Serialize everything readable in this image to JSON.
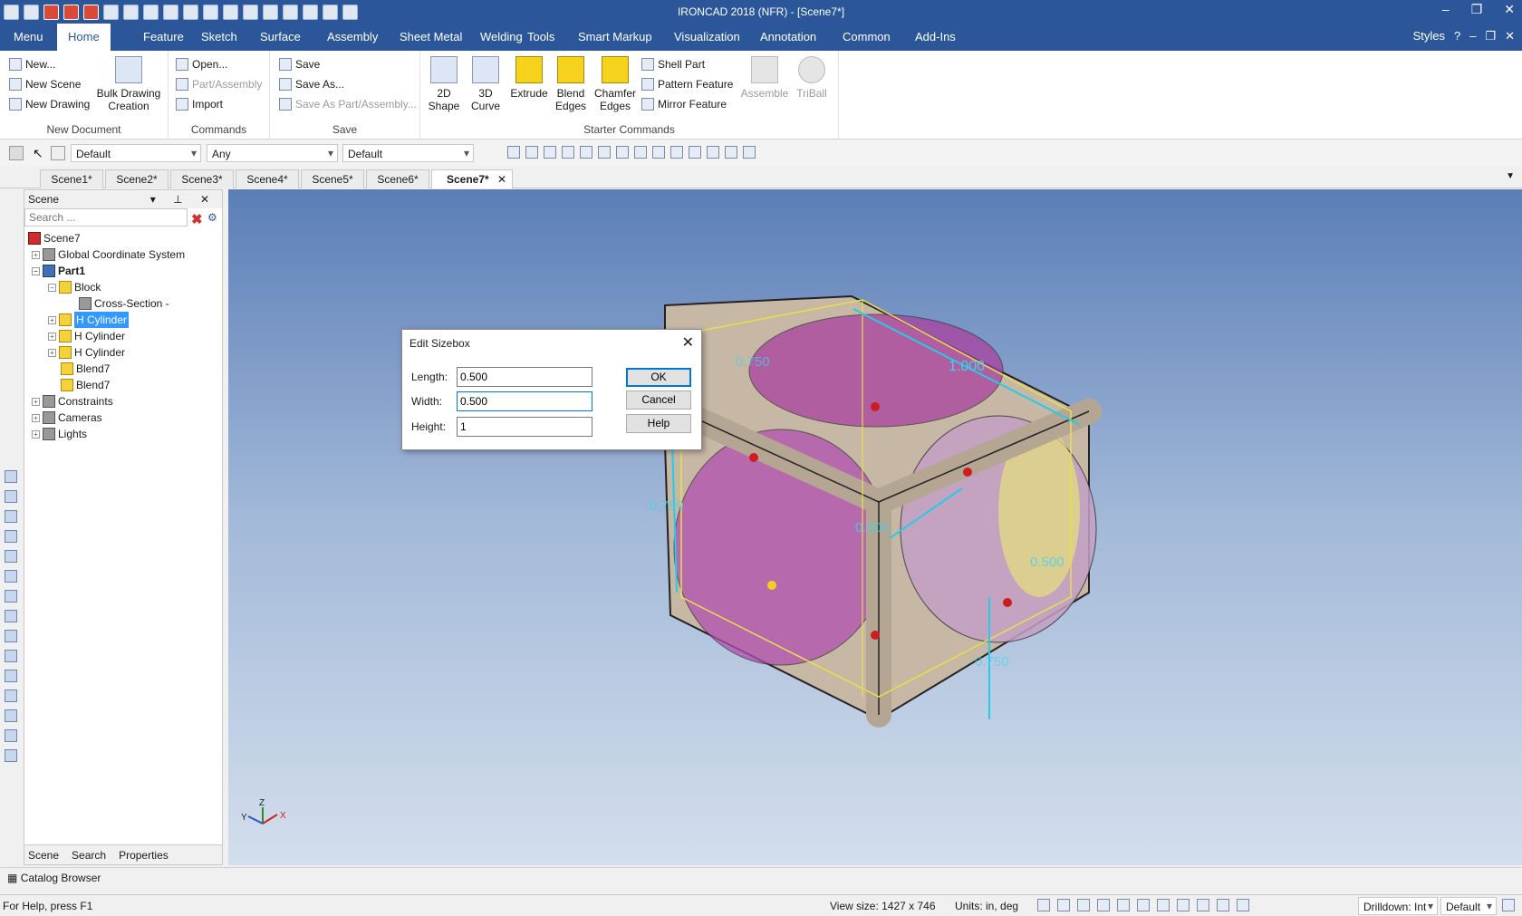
{
  "app": {
    "title": "IRONCAD 2018 (NFR) - [Scene7*]"
  },
  "menu_tabs": [
    "Menu",
    "Home",
    "Feature",
    "Sketch",
    "Surface",
    "Assembly",
    "Sheet Metal",
    "Welding",
    "Tools",
    "Smart Markup",
    "Visualization",
    "Annotation",
    "Common",
    "Add-Ins"
  ],
  "active_tab": "Home",
  "styles_label": "Styles",
  "ribbon": {
    "new_document": {
      "label": "New Document",
      "new": "New...",
      "new_scene": "New Scene",
      "new_drawing": "New Drawing",
      "bulk_line1": "Bulk Drawing",
      "bulk_line2": "Creation"
    },
    "commands": {
      "label": "Commands",
      "open": "Open...",
      "part_assembly": "Part/Assembly",
      "import": "Import"
    },
    "save": {
      "label": "Save",
      "save": "Save",
      "save_as": "Save As...",
      "save_as_part": "Save As Part/Assembly..."
    },
    "starter": {
      "label": "Starter Commands",
      "shape2d_1": "2D",
      "shape2d_2": "Shape",
      "curve3d_1": "3D",
      "curve3d_2": "Curve",
      "extrude": "Extrude",
      "blend_1": "Blend",
      "blend_2": "Edges",
      "chamfer_1": "Chamfer",
      "chamfer_2": "Edges",
      "shell": "Shell Part",
      "pattern": "Pattern Feature",
      "mirror": "Mirror Feature",
      "assemble": "Assemble",
      "triball": "TriBall"
    }
  },
  "toolbar2": {
    "combo1": "Default",
    "combo2": "Any",
    "combo3": "Default"
  },
  "doc_tabs": [
    "Scene1*",
    "Scene2*",
    "Scene3*",
    "Scene4*",
    "Scene5*",
    "Scene6*",
    "Scene7*"
  ],
  "scene_panel": {
    "title": "Scene",
    "search_placeholder": "Search ...",
    "tree": [
      "Scene7",
      "Global Coordinate System",
      "Part1",
      "Block",
      "Cross-Section -",
      "H Cylinder",
      "H Cylinder",
      "H Cylinder",
      "Blend7",
      "Blend7",
      "Constraints",
      "Cameras",
      "Lights"
    ],
    "bottom_tabs": [
      "Scene",
      "Search",
      "Properties"
    ]
  },
  "dialog": {
    "title": "Edit Sizebox",
    "length_label": "Length:",
    "length_value": "0.500",
    "width_label": "Width:",
    "width_value": "0.500",
    "height_label": "Height:",
    "height_value": "1",
    "ok": "OK",
    "cancel": "Cancel",
    "help": "Help"
  },
  "dimensions": {
    "d1": "1.000",
    "d2": "0.750",
    "d3": "0.750",
    "d4": "0.500",
    "d5": "0.500",
    "d6": "0.750"
  },
  "axis": {
    "x": "X",
    "y": "Y",
    "z": "Z"
  },
  "catalog_browser": "Catalog Browser",
  "status": {
    "help": "For Help, press F1",
    "view_size": "View size: 1427 x 746",
    "units": "Units: in, deg",
    "drilldown": "Drilldown: Int",
    "default": "Default"
  },
  "colors": {
    "ribbon_blue": "#2b579a",
    "selection": "#3399ff",
    "part_tan": "#c9b8a6",
    "magenta": "#b040b0",
    "cyan_dim": "#1fc8e6"
  }
}
